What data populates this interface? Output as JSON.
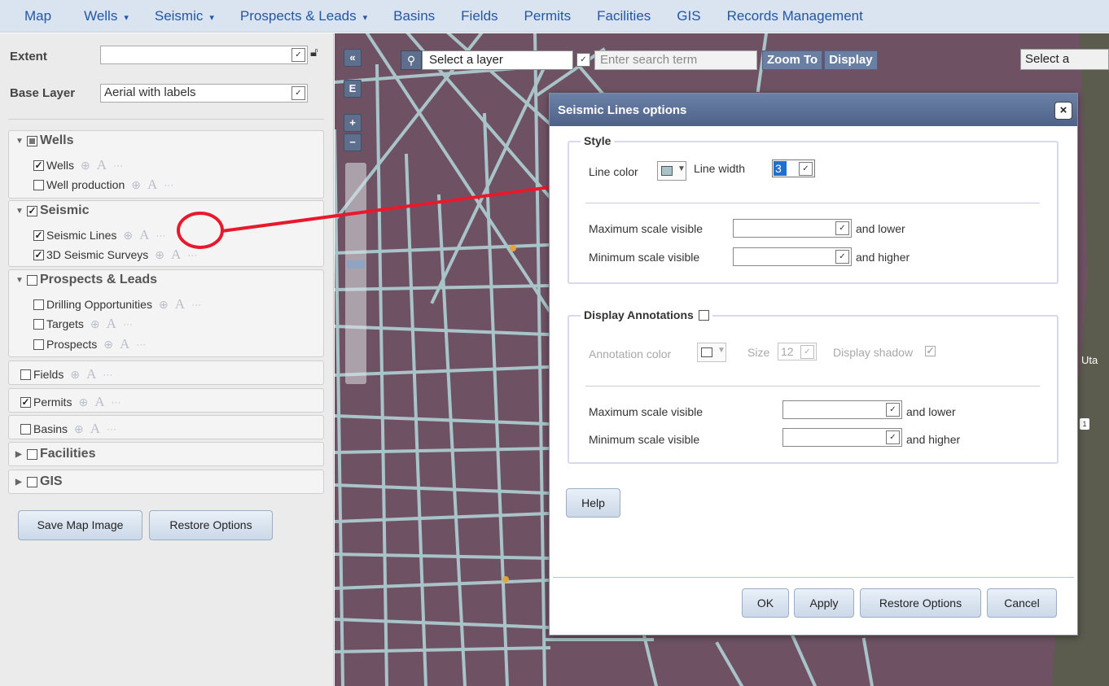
{
  "nav": {
    "items": [
      {
        "label": "Map",
        "caret": false
      },
      {
        "label": "Wells",
        "caret": true
      },
      {
        "label": "Seismic",
        "caret": true
      },
      {
        "label": "Prospects & Leads",
        "caret": true
      },
      {
        "label": "Basins",
        "caret": false
      },
      {
        "label": "Fields",
        "caret": false
      },
      {
        "label": "Permits",
        "caret": false
      },
      {
        "label": "Facilities",
        "caret": false
      },
      {
        "label": "GIS",
        "caret": false
      },
      {
        "label": "Records Management",
        "caret": false
      }
    ],
    "caret_glyph": "▾"
  },
  "left": {
    "extent_label": "Extent",
    "extent_value": "",
    "base_layer_label": "Base Layer",
    "base_layer_value": "Aerial with labels",
    "groups": {
      "wells": {
        "title": "Wells",
        "layers": [
          "Wells",
          "Well production"
        ]
      },
      "seismic": {
        "title": "Seismic",
        "layers": [
          "Seismic Lines",
          "3D Seismic Surveys"
        ]
      },
      "prospects": {
        "title": "Prospects & Leads",
        "layers": [
          "Drilling Opportunities",
          "Targets",
          "Prospects"
        ]
      },
      "fields": {
        "title": "Fields"
      },
      "permits": {
        "title": "Permits"
      },
      "basins": {
        "title": "Basins"
      },
      "facilities": {
        "title": "Facilities"
      },
      "gis": {
        "title": "GIS"
      }
    },
    "tools": {
      "zoom": "⊕",
      "annotate": "A",
      "more": "···"
    },
    "save_button": "Save Map Image",
    "restore_button": "Restore Options"
  },
  "map": {
    "controls": {
      "collapse": "«",
      "extent": "E",
      "zoom_in": "+",
      "zoom_out": "−"
    },
    "search": {
      "icon": "search-icon",
      "layer_select": "Select a layer",
      "placeholder": "Enter search term",
      "zoom_to": "Zoom To",
      "display": "Display"
    },
    "right_select": "Select a",
    "place_label": "Uta",
    "road_shield": "1"
  },
  "dialog": {
    "title": "Seismic Lines options",
    "close": "×",
    "style": {
      "legend": "Style",
      "line_color_label": "Line color",
      "line_color": "#a8c4c8",
      "line_width_label": "Line width",
      "line_width_value": "3",
      "max_scale_label": "Maximum scale visible",
      "max_scale_suffix": "and lower",
      "min_scale_label": "Minimum scale visible",
      "min_scale_suffix": "and higher"
    },
    "annotations": {
      "legend": "Display Annotations",
      "color_label": "Annotation color",
      "size_label": "Size",
      "size_value": "12",
      "shadow_label": "Display shadow",
      "max_scale_label": "Maximum scale visible",
      "max_scale_suffix": "and lower",
      "min_scale_label": "Minimum scale visible",
      "min_scale_suffix": "and higher"
    },
    "help": "Help",
    "ok": "OK",
    "apply": "Apply",
    "restore": "Restore Options",
    "cancel": "Cancel"
  },
  "colors": {
    "nav_bg": "#d9e4f0",
    "nav_text": "#2457a3",
    "map_bg": "#6e5263",
    "seismic_line": "#a8c4c8",
    "dialog_title": "#5a6e94",
    "annotation_marker": "#e8192c"
  }
}
